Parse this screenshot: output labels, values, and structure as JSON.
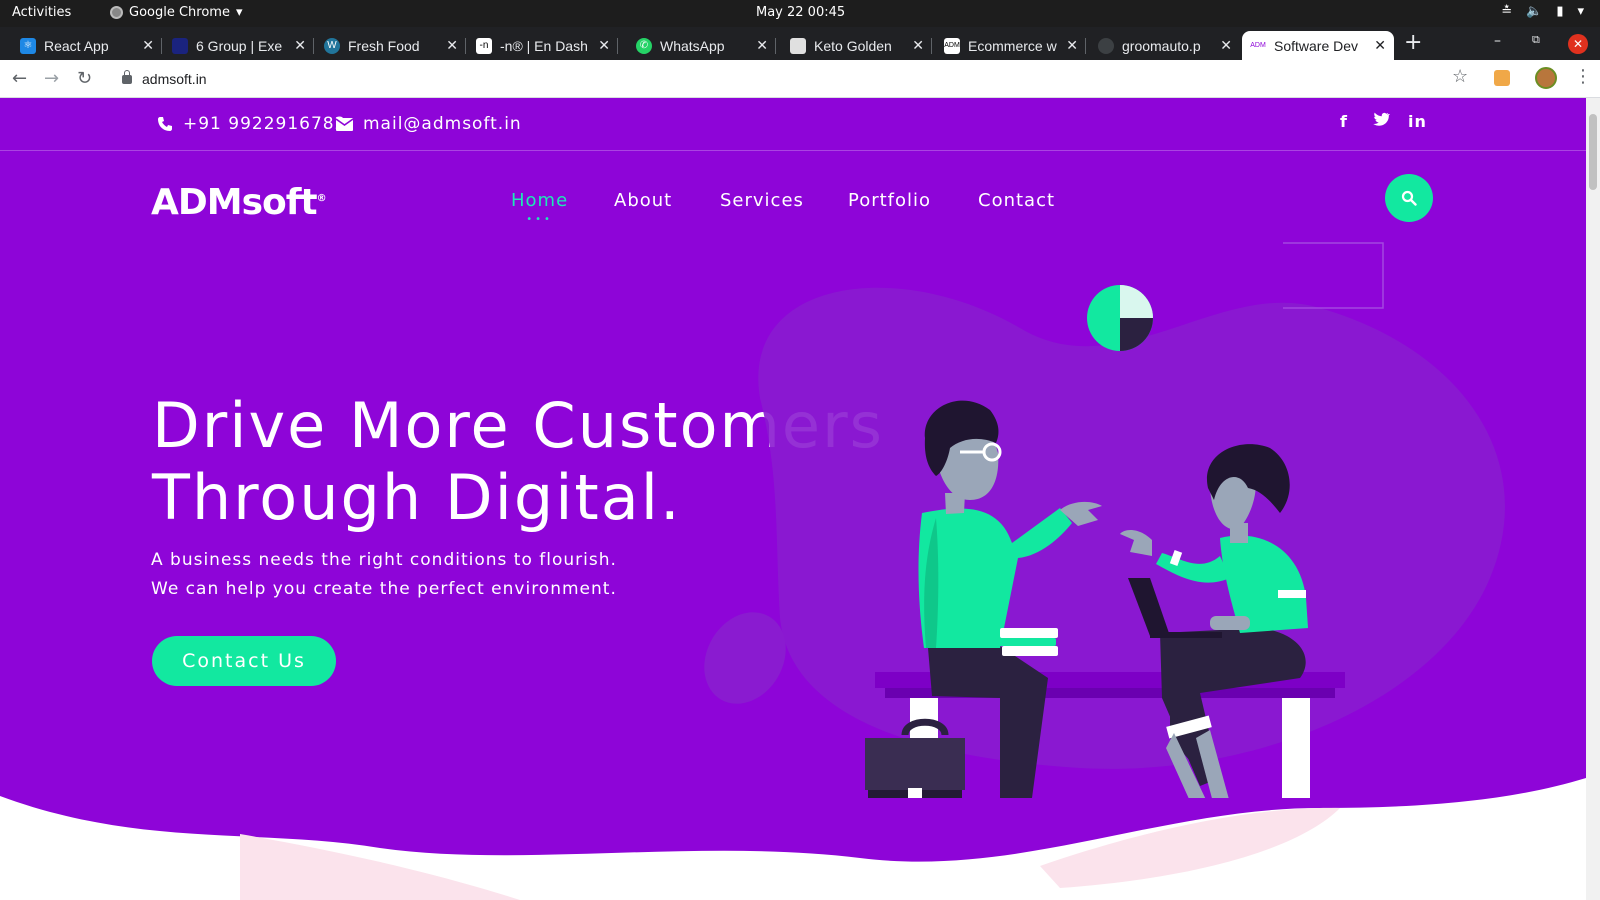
{
  "os_bar": {
    "activities": "Activities",
    "app_name": "Google Chrome",
    "clock": "May 22  00:45"
  },
  "browser": {
    "tabs": [
      {
        "label": "React App",
        "favicon_color": "#61dafb"
      },
      {
        "label": "6 Group | Exe",
        "favicon_color": "#1a237e"
      },
      {
        "label": "Fresh Food",
        "favicon_color": "#21759b"
      },
      {
        "label": "-n® | En Dash",
        "favicon_color": "#333333"
      },
      {
        "label": "WhatsApp",
        "favicon_color": "#25d366"
      },
      {
        "label": "Keto Golden",
        "favicon_color": "#9e9e9e"
      },
      {
        "label": "Ecommerce w",
        "favicon_color": "#444444"
      },
      {
        "label": "groomauto.p",
        "favicon_color": "#3c4043"
      },
      {
        "label": "Software Dev",
        "favicon_color": "#8e05d8"
      }
    ],
    "url": "admsoft.in"
  },
  "site": {
    "phone": "+91 9922916782",
    "email": "mail@admsoft.in",
    "social": [
      "f",
      "t",
      "in"
    ],
    "logo": "ADMsoft",
    "logo_mark": "®",
    "nav": [
      {
        "label": "Home",
        "active": true
      },
      {
        "label": "About",
        "active": false
      },
      {
        "label": "Services",
        "active": false
      },
      {
        "label": "Portfolio",
        "active": false
      },
      {
        "label": "Contact",
        "active": false
      }
    ],
    "hero": {
      "title_line1": "Drive More Customers",
      "title_line2": "Through Digital.",
      "sub_line1": "A business needs the right conditions to flourish.",
      "sub_line2": "We can help you create the perfect environment.",
      "cta": "Contact Us"
    }
  },
  "colors": {
    "brand_purple": "#8e05d8",
    "accent_green": "#12e8a0",
    "active_nav": "#1de9b6"
  }
}
